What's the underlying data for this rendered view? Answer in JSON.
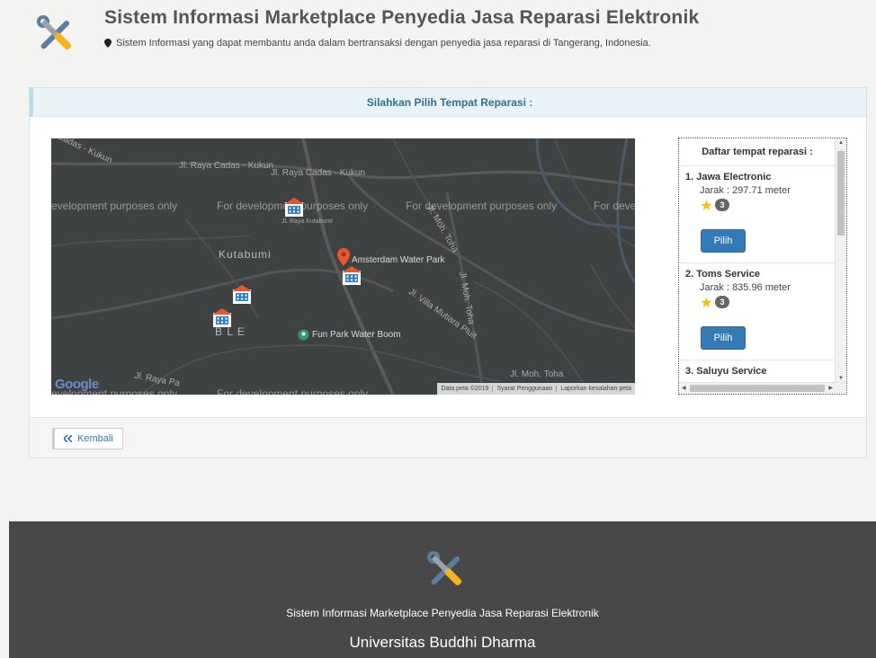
{
  "header": {
    "title": "Sistem Informasi Marketplace Penyedia Jasa Reparasi Elektronik",
    "subtitle": "Sistem Informasi yang dapat membantu anda dalam bertransaksi dengan penyedia jasa reparasi di Tangerang, Indonesia."
  },
  "panel": {
    "heading": "Silahkan Pilih Tempat Reparasi :",
    "back_label": "Kembali"
  },
  "map": {
    "watermark": "For development purposes only",
    "watermark_left": "evelopment purposes only",
    "watermark_right": "For deve",
    "labels": {
      "road1": "Jl. Raya Cadas - Kukun",
      "road2": "Jl. Raya Cadas - Kukun",
      "road3": "Cadas - Kukun",
      "kutabumi": "Kutabumi",
      "kutabumi_small": "Jl. Raya Kutabumi",
      "moh1": "Jl. Moh. Toha",
      "moh2": "Jl. Moh. Toha",
      "moh3": "Jl. Moh. Toha",
      "villa": "Jl. Villa Mutiara Pluit",
      "bl": "B L  E",
      "raya_pa": "Jl. Raya Pa"
    },
    "places": {
      "amsterdam": "Amsterdam Water Park",
      "funpark": "Fun Park Water Boom"
    },
    "attribution": {
      "data": "Data peta ©2019",
      "terms": "Syarat Penggunaan",
      "report": "Laporkan kesalahan peta"
    },
    "google": "Google"
  },
  "list": {
    "heading": "Daftar tempat reparasi :",
    "items": [
      {
        "name": "1. Jawa Electronic",
        "distance": "Jarak : 297.71 meter",
        "rating": "3",
        "button": "Pilih"
      },
      {
        "name": "2. Toms Service",
        "distance": "Jarak : 835.96 meter",
        "rating": "3",
        "button": "Pilih"
      },
      {
        "name": "3. Saluyu Service"
      }
    ]
  },
  "footer": {
    "line1": "Sistem Informasi Marketplace Penyedia Jasa Reparasi Elektronik",
    "line2": "Universitas Buddhi Dharma"
  },
  "colors": {
    "accent": "#337ab7",
    "panel_head": "#31708f",
    "footer_bg": "#484848"
  }
}
